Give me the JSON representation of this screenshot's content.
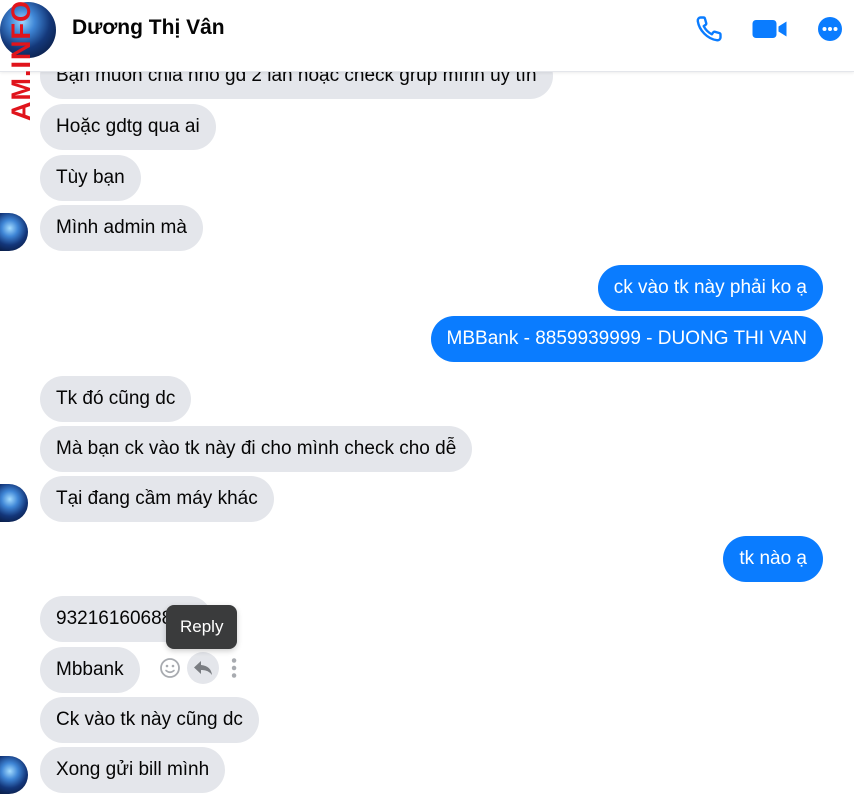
{
  "header": {
    "contact_name": "Dương Thị Vân",
    "icons": [
      "phone-icon",
      "video-camera-icon",
      "more-options-icon"
    ],
    "accent_color": "#0a7cff"
  },
  "watermark": "AM.INFO",
  "messages": [
    {
      "side": "in",
      "text": "Bạn muốn chia nhỏ gd 2 lần hoặc check grup mình uy tín"
    },
    {
      "side": "in",
      "text": "Hoặc gdtg qua ai"
    },
    {
      "side": "in",
      "text": "Tùy bạn"
    },
    {
      "side": "in",
      "text": "Mình admin mà"
    },
    {
      "side": "out",
      "text": "ck vào tk này phải ko ạ"
    },
    {
      "side": "out",
      "text": "MBBank - 8859939999 - DUONG THI VAN"
    },
    {
      "side": "in",
      "text": "Tk đó cũng dc"
    },
    {
      "side": "in",
      "text": "Mà bạn ck vào tk này đi cho mình check cho dễ"
    },
    {
      "side": "in",
      "text": "Tại đang cầm máy khác"
    },
    {
      "side": "out",
      "text": "tk nào ạ"
    },
    {
      "side": "in",
      "text": "93216160688888"
    },
    {
      "side": "in",
      "text": "Mbbank"
    },
    {
      "side": "in",
      "text": "Ck vào tk này cũng dc"
    },
    {
      "side": "in",
      "text": "Xong gửi bill mình"
    }
  ],
  "tooltip": "Reply",
  "message_actions": [
    "react-icon",
    "reply-icon",
    "more-icon"
  ],
  "colors": {
    "incoming_bubble": "#e4e6eb",
    "outgoing_bubble": "#0a7cff",
    "tooltip_bg": "#3a3b3c",
    "watermark": "#e0141c"
  }
}
